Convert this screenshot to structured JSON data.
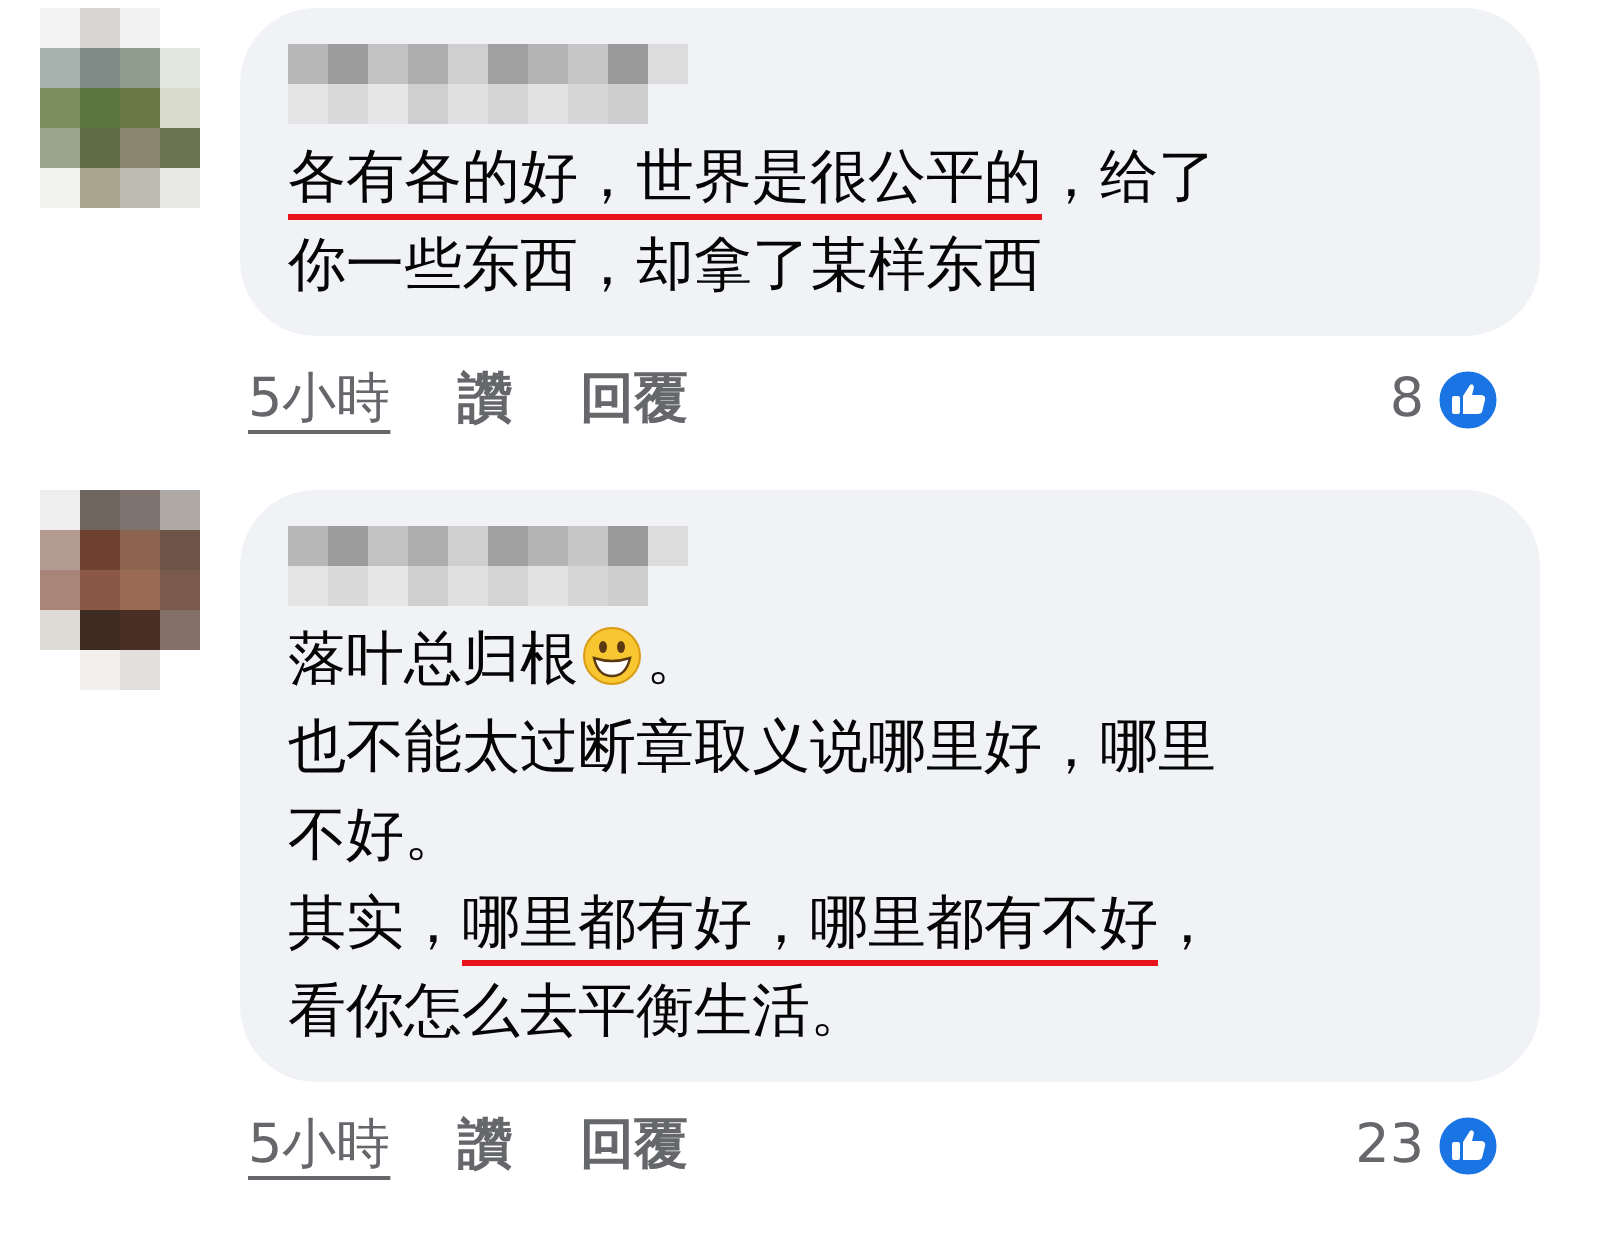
{
  "comments": [
    {
      "lines": [
        [
          {
            "text": "各有各的好，世界是很公平的",
            "underlined": true
          },
          {
            "text": "，给了",
            "underlined": false
          }
        ],
        [
          {
            "text": "你一些东西，却拿了某样东西",
            "underlined": false
          }
        ]
      ],
      "time": "5小時",
      "like_label": "讚",
      "reply_label": "回覆",
      "reactions": "8"
    },
    {
      "lines": [
        [
          {
            "text": "落叶总归根",
            "underlined": false
          },
          {
            "kind": "emoji"
          },
          {
            "text": "。",
            "underlined": false
          }
        ],
        [
          {
            "text": "也不能太过断章取义说哪里好，哪里",
            "underlined": false
          }
        ],
        [
          {
            "text": "不好。",
            "underlined": false
          }
        ],
        [
          {
            "text": "其实，",
            "underlined": false
          },
          {
            "text": "哪里都有好，哪里都有不好",
            "underlined": true
          },
          {
            "text": "，",
            "underlined": false
          }
        ],
        [
          {
            "text": "看你怎么去平衡生活。",
            "underlined": false
          }
        ]
      ],
      "time": "5小時",
      "like_label": "讚",
      "reply_label": "回覆",
      "reactions": "23"
    }
  ]
}
